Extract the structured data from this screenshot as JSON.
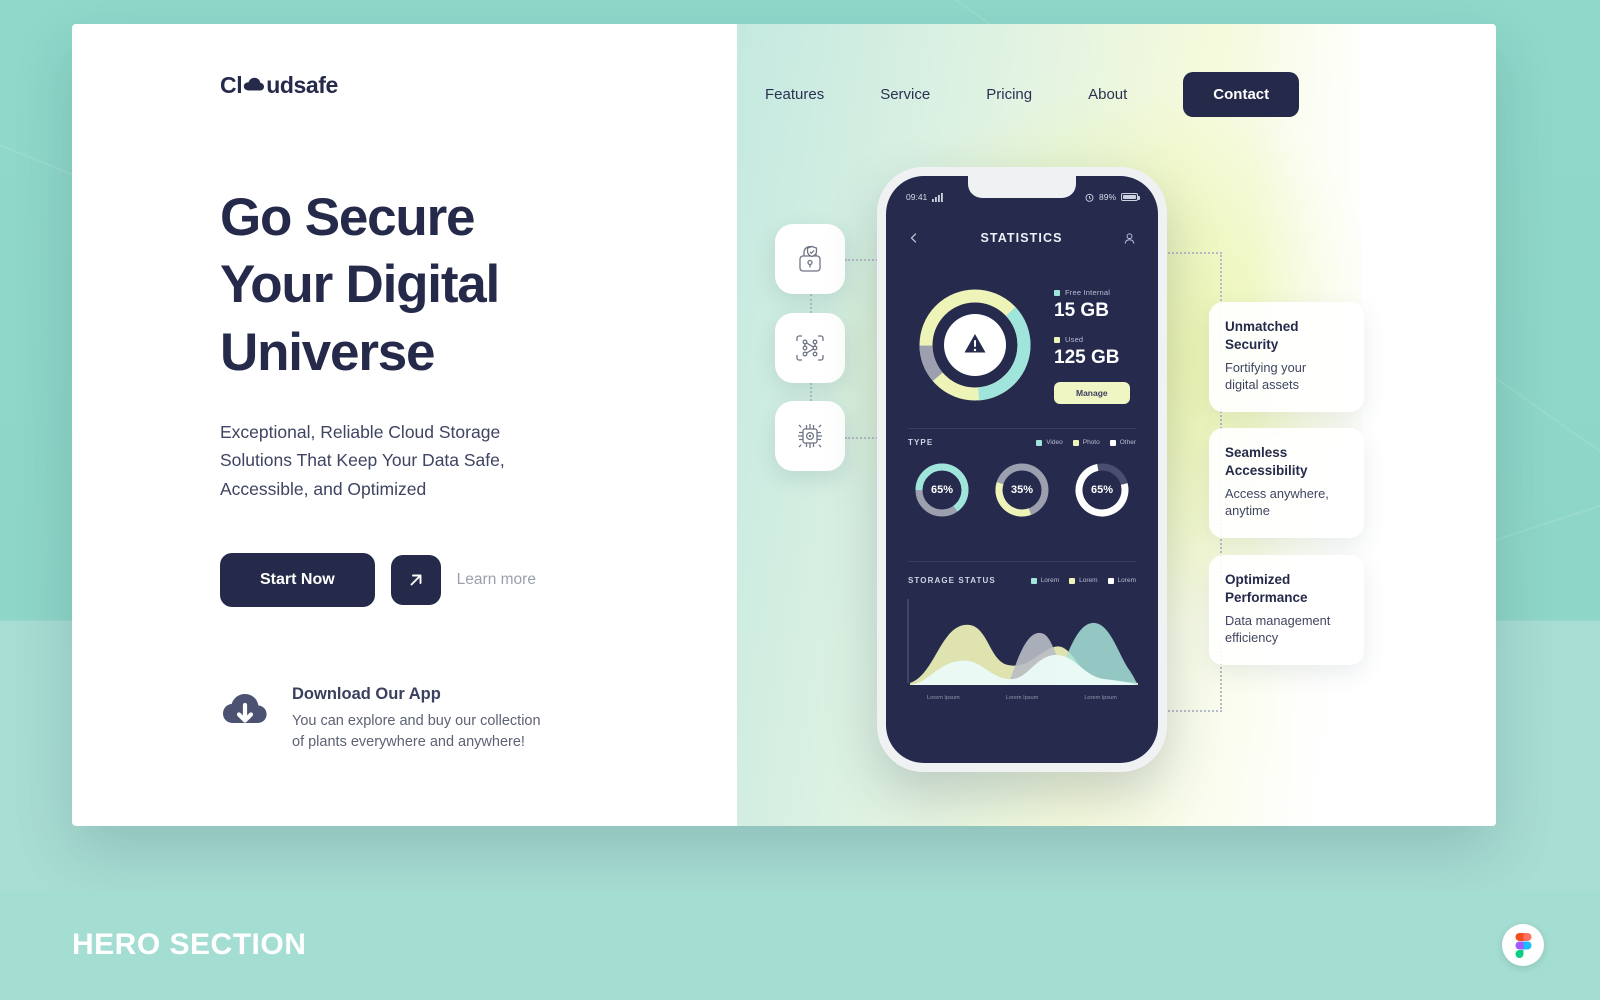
{
  "brand": {
    "name_before": "Cl",
    "name_after": "udsafe",
    "cloud_icon": "cloud-icon"
  },
  "nav": {
    "links": [
      {
        "label": "Features"
      },
      {
        "label": "Service"
      },
      {
        "label": "Pricing"
      },
      {
        "label": "About"
      }
    ],
    "cta": {
      "label": "Contact"
    }
  },
  "hero": {
    "headline": "Go Secure\nYour  Digital\nUniverse",
    "subtitle": "Exceptional, Reliable Cloud Storage\nSolutions That Keep Your Data Safe,\nAccessible, and Optimized",
    "primary_button": "Start Now",
    "arrow_button_icon": "arrow-up-right-icon",
    "secondary_link": "Learn more"
  },
  "download": {
    "icon": "cloud-download-icon",
    "title": "Download Our App",
    "description": "You can explore and buy our collection\nof plants everywhere and anywhere!"
  },
  "side_chips": [
    {
      "icon": "lock-shield-icon"
    },
    {
      "icon": "pattern-scan-icon"
    },
    {
      "icon": "chip-processor-icon"
    }
  ],
  "phone": {
    "status_bar": {
      "time": "09:41",
      "signal_icon": "signal-bars-icon",
      "alarm_icon": "alarm-clock-icon",
      "battery_percent": "89%"
    },
    "header": {
      "back_icon": "chevron-left-icon",
      "title": "STATISTICS",
      "profile_icon": "user-icon"
    },
    "storage": {
      "free": {
        "label": "Free Internal",
        "value": "15 GB",
        "color": "#9fe5dc"
      },
      "used": {
        "label": "Used",
        "value": "125 GB",
        "color": "#eef3b8"
      },
      "manage_button": "Manage",
      "warning_icon": "warning-triangle-icon"
    },
    "type_section": {
      "title": "TYPE",
      "legend": [
        {
          "label": "Video",
          "color": "#9fe5dc"
        },
        {
          "label": "Photo",
          "color": "#eef3b8"
        },
        {
          "label": "Other",
          "color": "#ffffff"
        }
      ],
      "donuts": [
        {
          "value": "65%",
          "pct": 65,
          "color": "#9fe5dc"
        },
        {
          "value": "35%",
          "pct": 35,
          "color": "#eef3b8"
        },
        {
          "value": "65%",
          "pct": 65,
          "color": "#ffffff"
        }
      ]
    },
    "storage_status": {
      "title": "STORAGE STATUS",
      "legend": [
        {
          "label": "Lorem",
          "color": "#9fe5dc"
        },
        {
          "label": "Lorem",
          "color": "#eef3b8"
        },
        {
          "label": "Lorem",
          "color": "#ffffff"
        }
      ],
      "x_labels": [
        "Lorem Ipsum",
        "Lorem Ipsum",
        "Lorem Ipsum"
      ]
    }
  },
  "feature_cards": [
    {
      "title": "Unmatched\nSecurity",
      "desc": "Fortifying your\ndigital assets"
    },
    {
      "title": "Seamless\nAccessibility",
      "desc": "Access anywhere,\nanytime"
    },
    {
      "title": "Optimized\nPerformance",
      "desc": "Data management\nefficiency"
    }
  ],
  "footer": {
    "caption": "HERO SECTION",
    "badge_icon": "figma-icon"
  },
  "colors": {
    "navy": "#252a4a",
    "teal_bg": "#8ed6c8",
    "teal_bar": "#a4ddd2",
    "accent_mint": "#9fe5dc",
    "accent_lime": "#eef3b8"
  },
  "chart_data": [
    {
      "type": "pie",
      "title": "Storage",
      "categories": [
        "Free Internal",
        "Used"
      ],
      "values": [
        15,
        125
      ],
      "unit": "GB",
      "legend": "right"
    },
    {
      "type": "pie",
      "title": "TYPE",
      "categories": [
        "Video",
        "Photo",
        "Other"
      ],
      "values": [
        65,
        35,
        65
      ],
      "unit": "%",
      "legend": "top-right"
    },
    {
      "type": "area",
      "title": "STORAGE STATUS",
      "x": [
        "Lorem Ipsum",
        "Lorem Ipsum",
        "Lorem Ipsum"
      ],
      "series": [
        {
          "name": "Lorem",
          "color": "#eef3b8",
          "values": [
            10,
            62,
            30,
            46,
            80,
            40
          ]
        },
        {
          "name": "Lorem",
          "color": "#b9bcc4",
          "values": [
            5,
            20,
            18,
            70,
            35,
            20
          ]
        },
        {
          "name": "Lorem",
          "color": "#e7f6f2",
          "values": [
            20,
            45,
            55,
            30,
            60,
            25
          ]
        }
      ],
      "grid": false,
      "legend": "top-right"
    }
  ]
}
